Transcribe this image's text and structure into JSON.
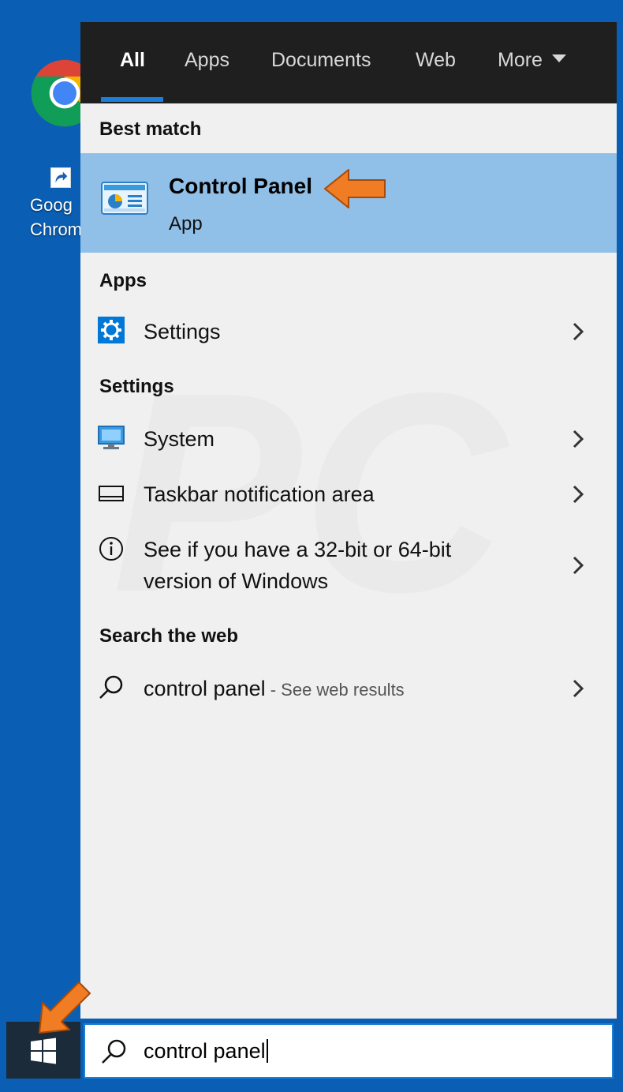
{
  "desktop": {
    "icon_label_line1": "Goog",
    "icon_label_line2": "Chrom"
  },
  "tabs": [
    {
      "label": "All",
      "active": true
    },
    {
      "label": "Apps"
    },
    {
      "label": "Documents"
    },
    {
      "label": "Web"
    },
    {
      "label": "More"
    }
  ],
  "best_match": {
    "heading": "Best match",
    "title": "Control Panel",
    "subtitle": "App"
  },
  "apps": {
    "heading": "Apps",
    "items": [
      {
        "label": "Settings",
        "icon": "gear-icon"
      }
    ]
  },
  "settings": {
    "heading": "Settings",
    "items": [
      {
        "label": "System",
        "icon": "monitor-icon"
      },
      {
        "label": "Taskbar notification area",
        "icon": "taskbar-icon"
      },
      {
        "label_line1": "See if you have a 32-bit or 64-bit",
        "label_line2": "version of Windows",
        "icon": "info-icon"
      }
    ]
  },
  "web": {
    "heading": "Search the web",
    "query": "control panel",
    "hint": " - See web results"
  },
  "search_box": {
    "value": "control panel"
  },
  "colors": {
    "desktop": "#0a5fb4",
    "tabbar": "#1f1f1f",
    "accent": "#1a7fd8",
    "highlight": "#90c0e8",
    "arrow": "#f07c24"
  }
}
